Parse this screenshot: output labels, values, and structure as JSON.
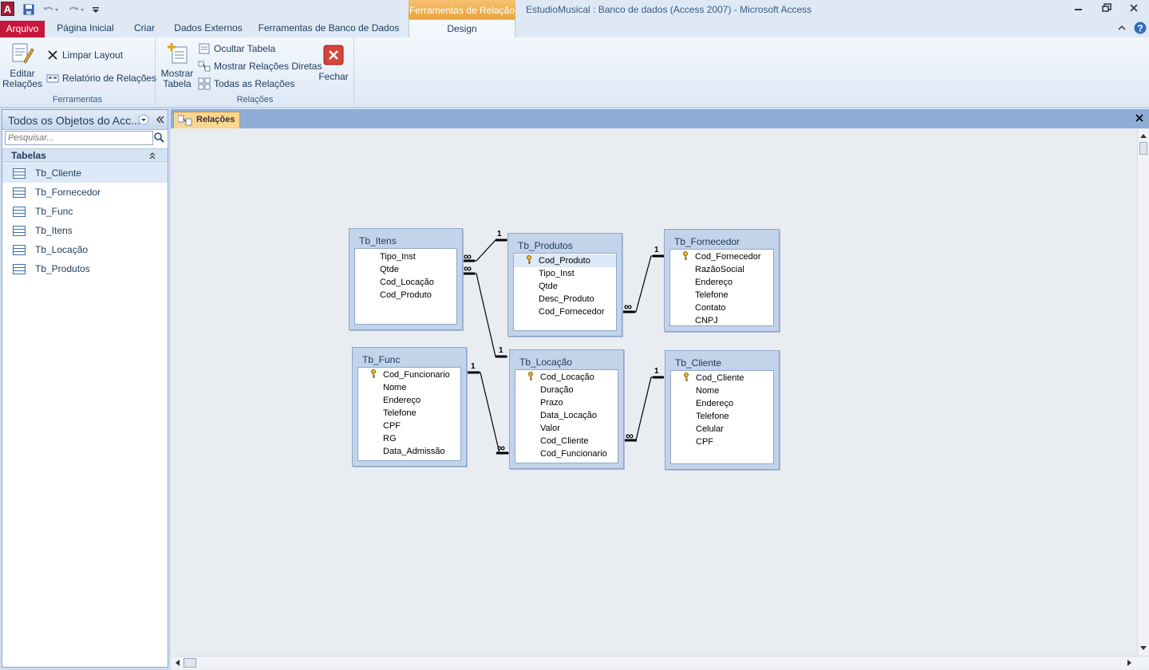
{
  "titlebar": {
    "context_tab": "Ferramentas de Relação",
    "title": "EstudioMusical : Banco de dados (Access 2007)  -  Microsoft Access",
    "logo_letter": "A"
  },
  "tabs": [
    {
      "label": "Arquivo"
    },
    {
      "label": "Página Inicial"
    },
    {
      "label": "Criar"
    },
    {
      "label": "Dados Externos"
    },
    {
      "label": "Ferramentas de Banco de Dados"
    },
    {
      "label": "Design"
    }
  ],
  "ribbon": {
    "ferramentas": {
      "label": "Ferramentas",
      "editar": "Editar\nRelações",
      "limpar": "Limpar Layout",
      "relatorio": "Relatório de Relações"
    },
    "relacoes": {
      "label": "Relações",
      "mostrar": "Mostrar\nTabela",
      "ocultar": "Ocultar Tabela",
      "diretas": "Mostrar Relações Diretas",
      "todas": "Todas as Relações",
      "fechar": "Fechar"
    }
  },
  "nav": {
    "title": "Todos os Objetos do Acc...",
    "search_placeholder": "Pesquisar...",
    "section": "Tabelas",
    "items": [
      "Tb_Cliente",
      "Tb_Fornecedor",
      "Tb_Func",
      "Tb_Itens",
      "Tb_Locação",
      "Tb_Produtos"
    ],
    "selected": "Tb_Cliente"
  },
  "document": {
    "tab_label": "Relações"
  },
  "tables": {
    "itens": {
      "name": "Tb_Itens",
      "fields": [
        "Tipo_Inst",
        "Qtde",
        "Cod_Locação",
        "Cod_Produto"
      ]
    },
    "produtos": {
      "name": "Tb_Produtos",
      "fields": [
        "Cod_Produto",
        "Tipo_Inst",
        "Qtde",
        "Desc_Produto",
        "Cod_Fornecedor"
      ],
      "key": "Cod_Produto"
    },
    "fornecedor": {
      "name": "Tb_Fornecedor",
      "fields": [
        "Cod_Fornecedor",
        "RazãoSocial",
        "Endereço",
        "Telefone",
        "Contato",
        "CNPJ"
      ],
      "key": "Cod_Fornecedor"
    },
    "func": {
      "name": "Tb_Func",
      "fields": [
        "Cod_Funcionario",
        "Nome",
        "Endereço",
        "Telefone",
        "CPF",
        "RG",
        "Data_Admissão"
      ],
      "key": "Cod_Funcionario"
    },
    "locacao": {
      "name": "Tb_Locação",
      "fields": [
        "Cod_Locação",
        "Duração",
        "Prazo",
        "Data_Locação",
        "Valor",
        "Cod_Cliente",
        "Cod_Funcionario"
      ],
      "key": "Cod_Locação"
    },
    "cliente": {
      "name": "Tb_Cliente",
      "fields": [
        "Cod_Cliente",
        "Nome",
        "Endereço",
        "Telefone",
        "Celular",
        "CPF"
      ],
      "key": "Cod_Cliente"
    }
  },
  "relationships": [
    {
      "from": "Tb_Itens.Cod_Produto",
      "to": "Tb_Produtos.Cod_Produto",
      "one": "1",
      "many": "∞"
    },
    {
      "from": "Tb_Itens.Cod_Locação",
      "to": "Tb_Locação.Cod_Locação",
      "one": "1",
      "many": "∞"
    },
    {
      "from": "Tb_Produtos.Cod_Fornecedor",
      "to": "Tb_Fornecedor.Cod_Fornecedor",
      "one": "1",
      "many": "∞"
    },
    {
      "from": "Tb_Locação.Cod_Funcionario",
      "to": "Tb_Func.Cod_Funcionario",
      "one": "1",
      "many": "∞"
    },
    {
      "from": "Tb_Locação.Cod_Cliente",
      "to": "Tb_Cliente.Cod_Cliente",
      "one": "1",
      "many": "∞"
    }
  ]
}
